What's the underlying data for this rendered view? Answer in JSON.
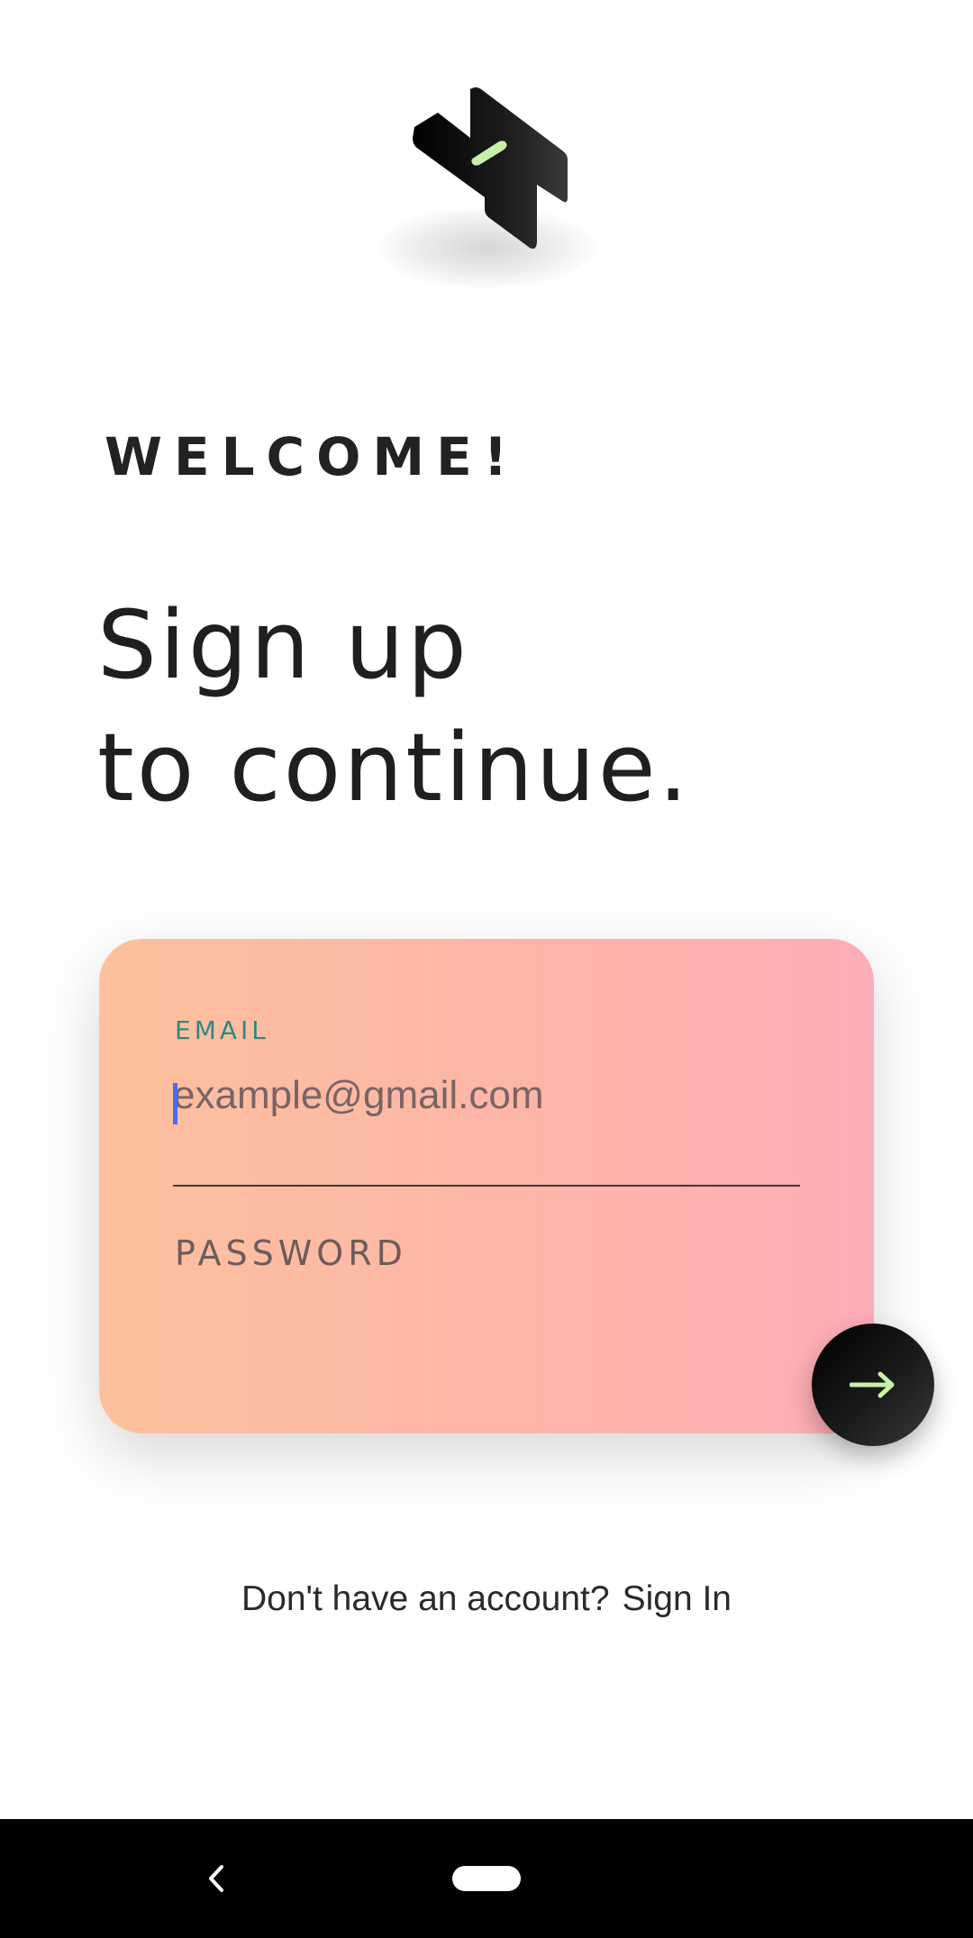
{
  "app": {
    "logo_icon": "cube-logo-icon"
  },
  "welcome_heading": "WELCOME!",
  "headline": {
    "line1": "Sign up",
    "line2": "to continue."
  },
  "form": {
    "email_label": "EMAIL",
    "email_placeholder": "example@gmail.com",
    "email_value": "",
    "password_label": "PASSWORD",
    "password_value": "",
    "submit_icon": "arrow-right-icon",
    "card_gradient": [
      "#fdc19e",
      "#fdadb7"
    ]
  },
  "footer": {
    "prompt": "Don't have an account?",
    "link": "Sign In"
  },
  "navbar": {
    "back_icon": "back-chevron-icon",
    "home_icon": "home-pill-icon"
  },
  "colors": {
    "accent_green": "#c8f0a8",
    "label_teal": "#2b8a7e",
    "caret_blue": "#4a6cf7",
    "text_dark": "#222222"
  }
}
